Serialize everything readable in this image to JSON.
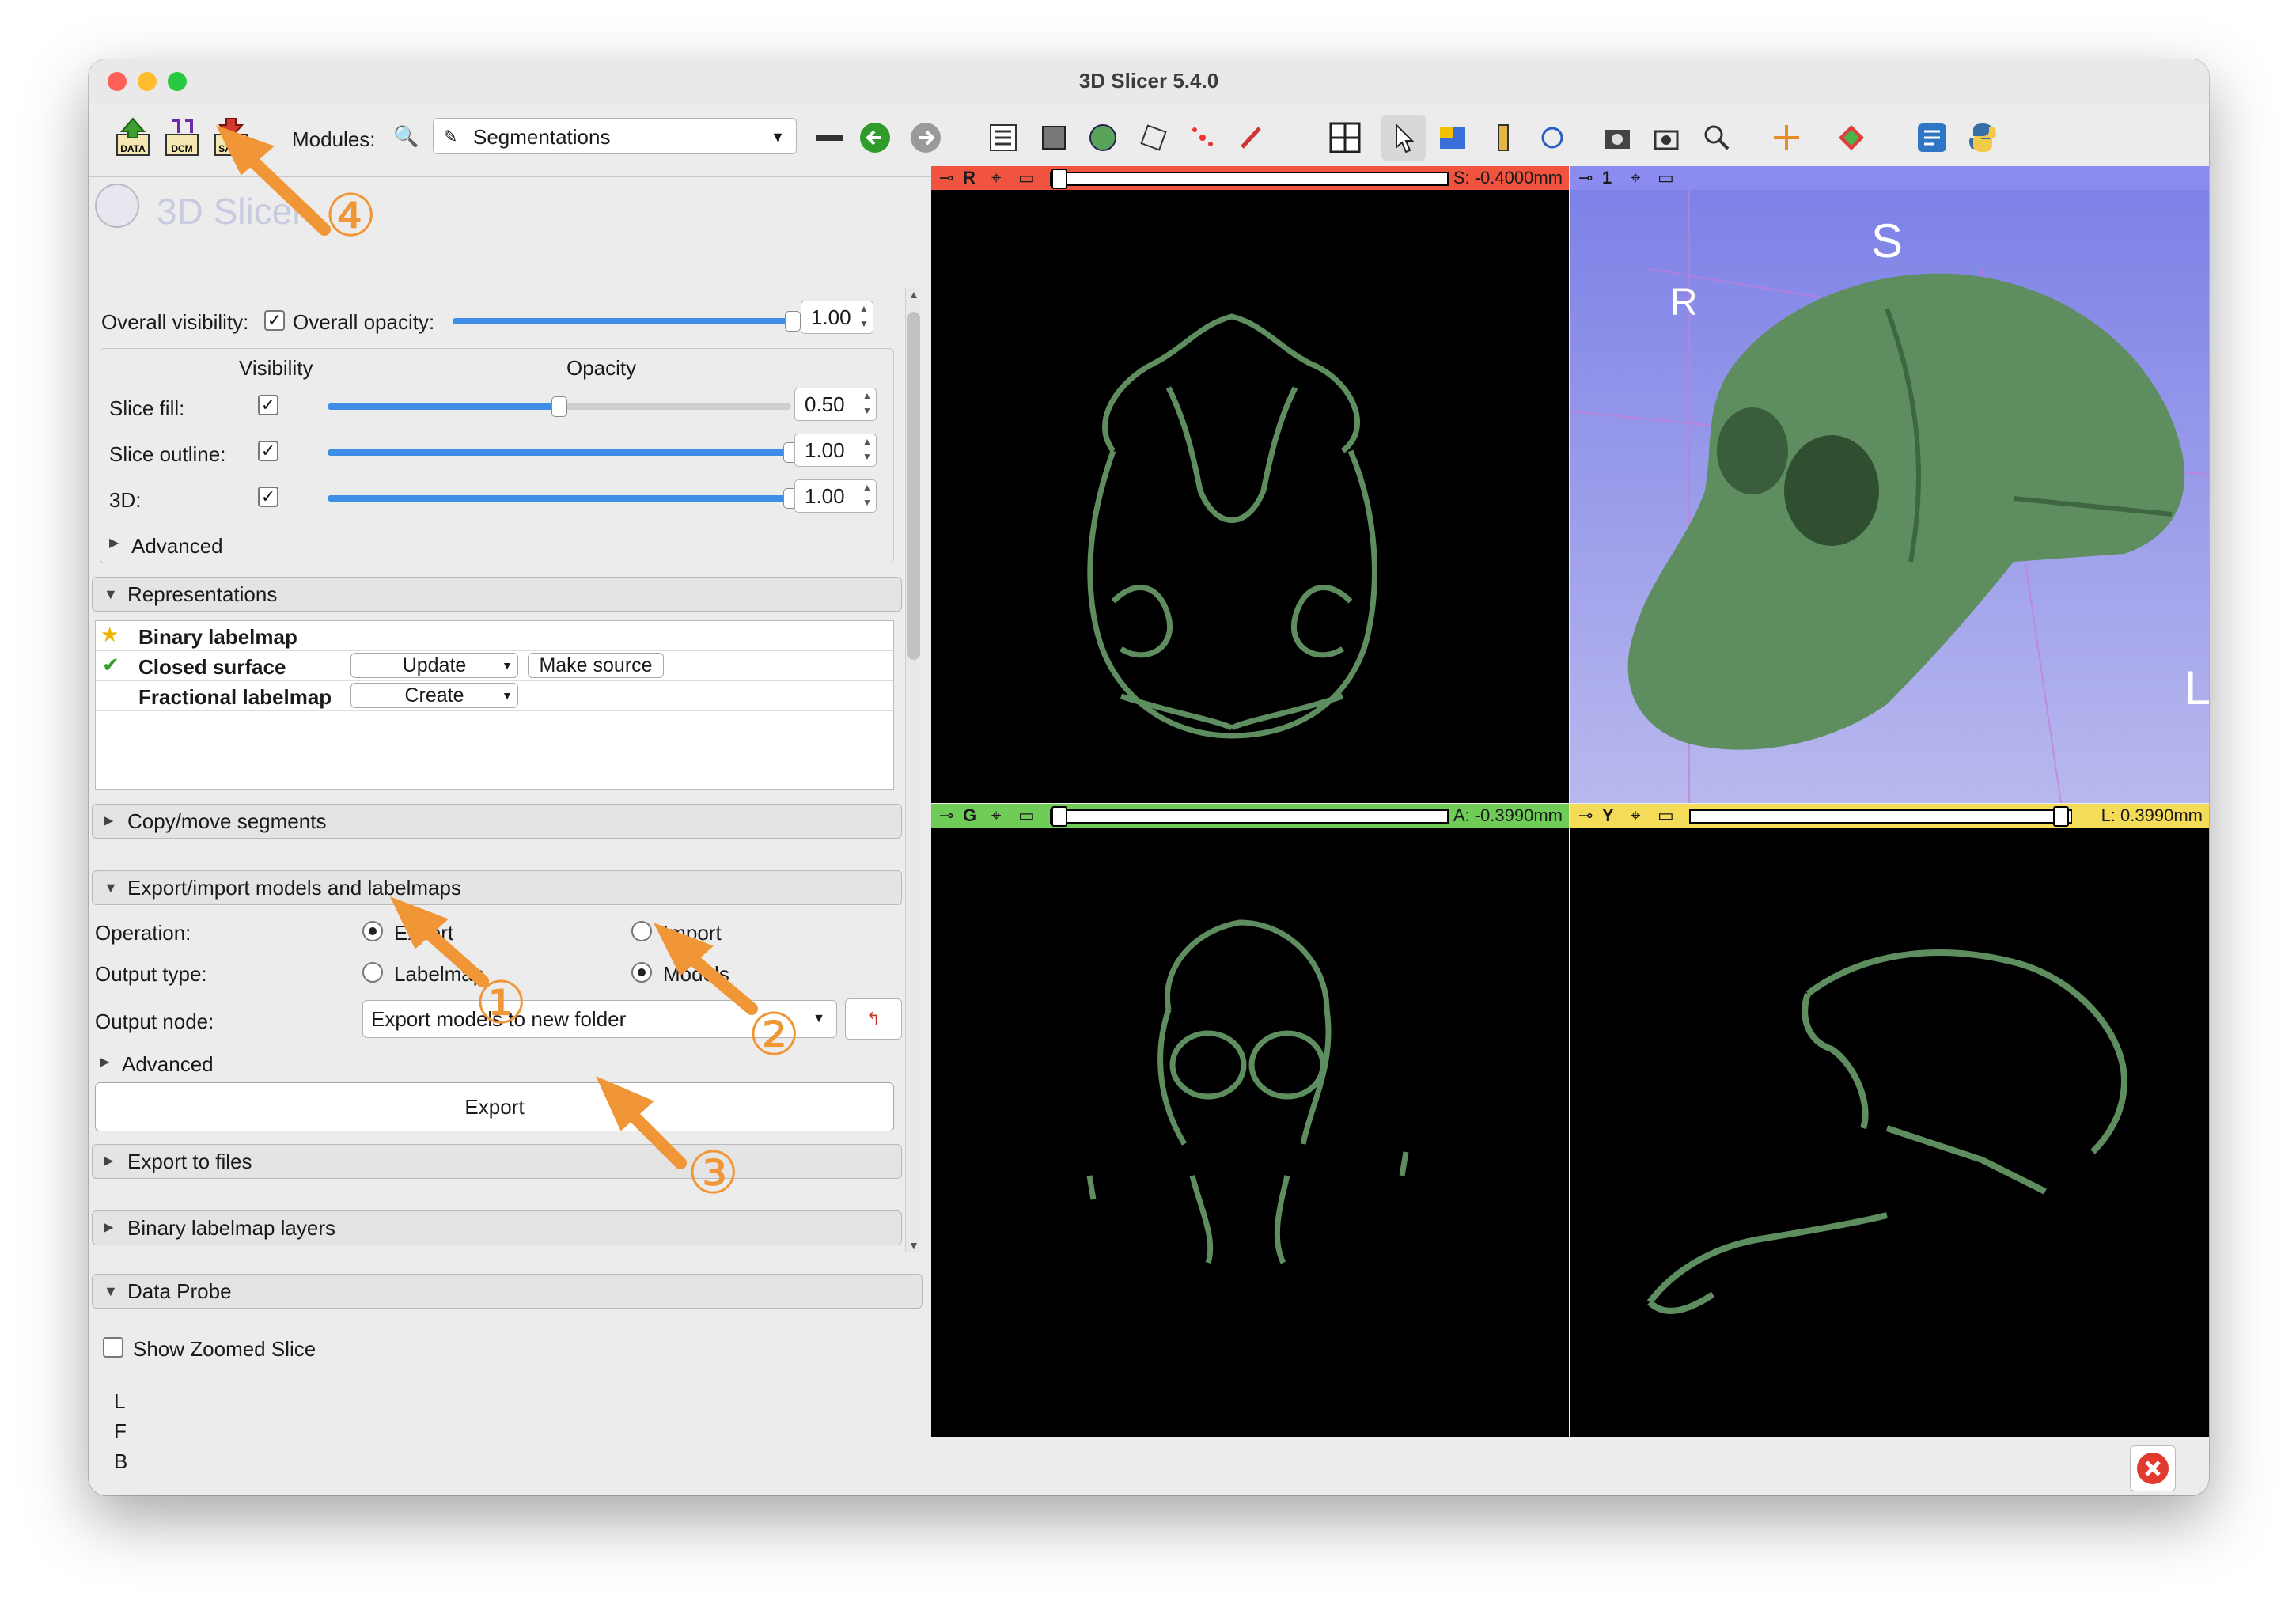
{
  "window": {
    "title": "3D Slicer 5.4.0"
  },
  "toolbar": {
    "buttons": [
      {
        "name": "data-icon",
        "label": "DATA"
      },
      {
        "name": "dcm-icon",
        "label": "DCM"
      },
      {
        "name": "save-icon",
        "label": "SAVE"
      }
    ],
    "modules_label": "Modules:",
    "module_selected": "Segmentations"
  },
  "logo": {
    "text": "3D Slicer"
  },
  "display": {
    "overall_visibility_label": "Overall visibility:",
    "overall_opacity_label": "Overall opacity:",
    "overall_opacity_value": "1.00",
    "overall_opacity_fraction": 1.0,
    "header_visibility": "Visibility",
    "header_opacity": "Opacity",
    "rows": [
      {
        "label": "Slice fill:",
        "value": "0.50",
        "fraction": 0.5
      },
      {
        "label": "Slice outline:",
        "value": "1.00",
        "fraction": 1.0
      },
      {
        "label": "3D:",
        "value": "1.00",
        "fraction": 1.0
      }
    ],
    "advanced_label": "Advanced"
  },
  "representations": {
    "title": "Representations",
    "items": [
      {
        "name": "Binary labelmap",
        "status": "star"
      },
      {
        "name": "Closed surface",
        "status": "check",
        "action": "Update",
        "extra": "Make source"
      },
      {
        "name": "Fractional labelmap",
        "status": "",
        "action": "Create"
      }
    ]
  },
  "copy_move": {
    "title": "Copy/move segments"
  },
  "export_import": {
    "title": "Export/import models and labelmaps",
    "operation_label": "Operation:",
    "operation_export": "Export",
    "operation_import": "Import",
    "output_type_label": "Output type:",
    "output_type_labelmap": "Labelmap",
    "output_type_models": "Models",
    "output_node_label": "Output node:",
    "output_node_value": "Export models to new folder",
    "advanced_label": "Advanced",
    "export_button": "Export"
  },
  "export_files": {
    "title": "Export to files"
  },
  "binary_layers": {
    "title": "Binary labelmap layers"
  },
  "data_probe": {
    "title": "Data Probe",
    "show_zoomed": "Show Zoomed Slice",
    "lines": [
      "L",
      "F",
      "B"
    ]
  },
  "views": {
    "red": {
      "tag": "R",
      "value": "S: -0.4000mm",
      "color": "#f0533e"
    },
    "three_d": {
      "tag": "1",
      "color": "#8c8cf0",
      "axis_s": "S",
      "axis_r": "R",
      "axis_l": "L"
    },
    "green": {
      "tag": "G",
      "value": "A: -0.3990mm",
      "color": "#6fcd57"
    },
    "yellow": {
      "tag": "Y",
      "value": "L: 0.3990mm",
      "color": "#f5dc58"
    }
  },
  "annotations": [
    "④",
    "①",
    "②",
    "③"
  ],
  "colors": {
    "segment": "#5e8e5f",
    "accent": "#f19637"
  }
}
